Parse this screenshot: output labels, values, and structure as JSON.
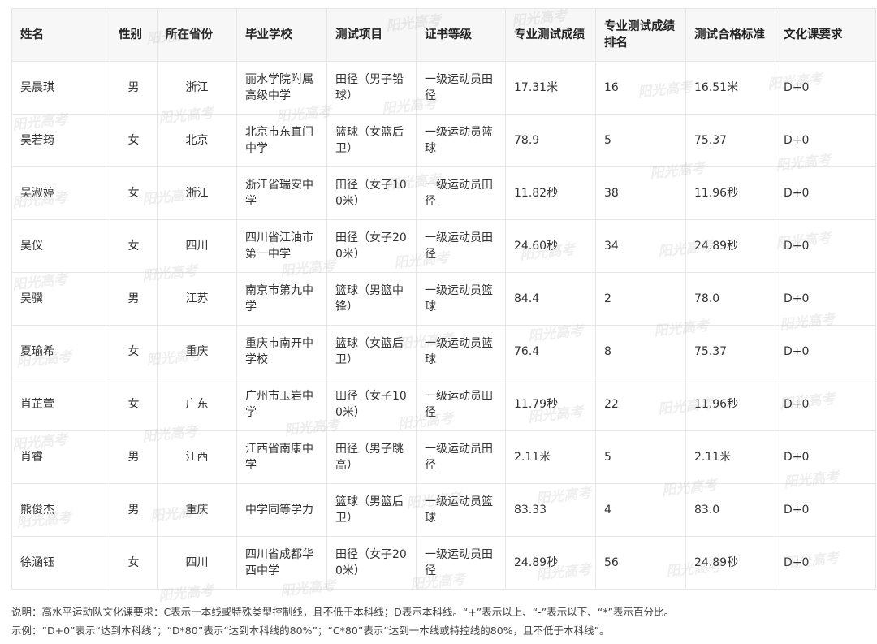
{
  "table": {
    "headers": [
      "姓名",
      "性别",
      "所在省份",
      "毕业学校",
      "测试项目",
      "证书等级",
      "专业测试成绩",
      "专业测试成绩排名",
      "测试合格标准",
      "文化课要求"
    ],
    "rows": [
      [
        "吴晨琪",
        "男",
        "浙江",
        "丽水学院附属高级中学",
        "田径（男子铅球）",
        "一级运动员田径",
        "17.31米",
        "16",
        "16.51米",
        "D+0"
      ],
      [
        "吴若筠",
        "女",
        "北京",
        "北京市东直门中学",
        "篮球（女篮后卫）",
        "一级运动员篮球",
        "78.9",
        "5",
        "75.37",
        "D+0"
      ],
      [
        "吴淑婷",
        "女",
        "浙江",
        "浙江省瑞安中学",
        "田径（女子100米）",
        "一级运动员田径",
        "11.82秒",
        "38",
        "11.96秒",
        "D+0"
      ],
      [
        "吴仪",
        "女",
        "四川",
        "四川省江油市第一中学",
        "田径（女子200米）",
        "一级运动员田径",
        "24.60秒",
        "34",
        "24.89秒",
        "D+0"
      ],
      [
        "吴骥",
        "男",
        "江苏",
        "南京市第九中学",
        "篮球（男篮中锋）",
        "一级运动员篮球",
        "84.4",
        "2",
        "78.0",
        "D+0"
      ],
      [
        "夏瑜希",
        "女",
        "重庆",
        "重庆市南开中学校",
        "篮球（女篮后卫）",
        "一级运动员篮球",
        "76.4",
        "8",
        "75.37",
        "D+0"
      ],
      [
        "肖芷萱",
        "女",
        "广东",
        "广州市玉岩中学",
        "田径（女子100米）",
        "一级运动员田径",
        "11.79秒",
        "22",
        "11.96秒",
        "D+0"
      ],
      [
        "肖睿",
        "男",
        "江西",
        "江西省南康中学",
        "田径（男子跳高）",
        "一级运动员田径",
        "2.11米",
        "5",
        "2.11米",
        "D+0"
      ],
      [
        "熊俊杰",
        "男",
        "重庆",
        "中学同等学力",
        "篮球（男篮后卫）",
        "一级运动员篮球",
        "83.33",
        "4",
        "83.0",
        "D+0"
      ],
      [
        "徐涵钰",
        "女",
        "四川",
        "四川省成都华西中学",
        "田径（女子200米）",
        "一级运动员田径",
        "24.89秒",
        "56",
        "24.89秒",
        "D+0"
      ]
    ]
  },
  "notes": {
    "line1": "说明：高水平运动队文化课要求：C表示一本线或特殊类型控制线，且不低于本科线；D表示本科线。“+”表示以上、“-”表示以下、“*”表示百分比。",
    "line2": "示例：“D+0”表示“达到本科线”；“D*80”表示“达到本科线的80%”；“C*80”表示“达到一本线或特控线的80%，且不低于本科线”。"
  },
  "watermark_text": "阳光高考"
}
